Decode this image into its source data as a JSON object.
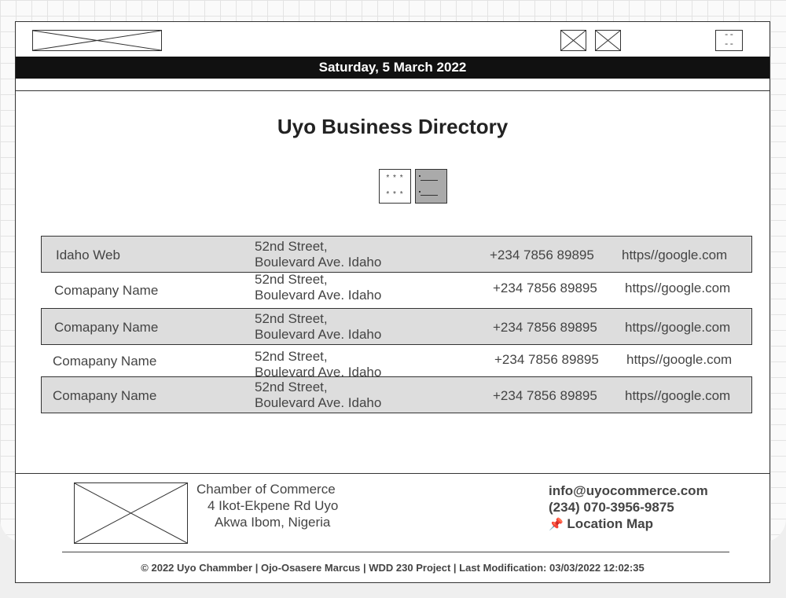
{
  "header": {
    "date": "Saturday, 5 March 2022",
    "menu_glyph_top": "--",
    "menu_glyph_bottom": "--",
    "logo_icon": "placeholder-image-icon",
    "social_icons": [
      "placeholder-image-icon",
      "placeholder-image-icon"
    ]
  },
  "main": {
    "title": "Uyo Business Directory",
    "view_toggle": {
      "grid_glyph_row": "* * *",
      "active": "list"
    },
    "directory": [
      {
        "name": "Idaho Web",
        "address_line1": "52nd Street,",
        "address_line2": "Boulevard Ave. Idaho",
        "phone": "+234 7856 89895",
        "website": "https//google.com",
        "shaded": true
      },
      {
        "name": "Comapany Name",
        "address_line1": "52nd Street,",
        "address_line2": "Boulevard Ave. Idaho",
        "phone": "+234 7856 89895",
        "website": "https//google.com",
        "shaded": false
      },
      {
        "name": "Comapany Name",
        "address_line1": "52nd Street,",
        "address_line2": "Boulevard Ave. Idaho",
        "phone": "+234 7856 89895",
        "website": "https//google.com",
        "shaded": true
      },
      {
        "name": "Comapany Name",
        "address_line1": "52nd Street,",
        "address_line2": "Boulevard Ave. Idaho",
        "phone": "+234 7856 89895",
        "website": "https//google.com",
        "shaded": false
      },
      {
        "name": "Comapany Name",
        "address_line1": "52nd Street,",
        "address_line2": "Boulevard Ave. Idaho",
        "phone": "+234 7856 89895",
        "website": "https//google.com",
        "shaded": true
      }
    ]
  },
  "footer": {
    "chamber_name": "Chamber of Commerce",
    "address_line1": "4 Ikot-Ekpene Rd Uyo",
    "address_line2": "Akwa Ibom, Nigeria",
    "email": "info@uyocommerce.com",
    "phone": "(234) 070-3956-9875",
    "pin_icon": "📌",
    "map_link": "Location Map",
    "copyright": "© 2022 Uyo Chammber | Ojo-Osasere Marcus | WDD 230 Project | Last Modification: 03/03/2022 12:02:35"
  },
  "colors": {
    "date_bar": "#111111",
    "row_shade": "#dddddd",
    "active_toggle": "#aaaaaa"
  }
}
